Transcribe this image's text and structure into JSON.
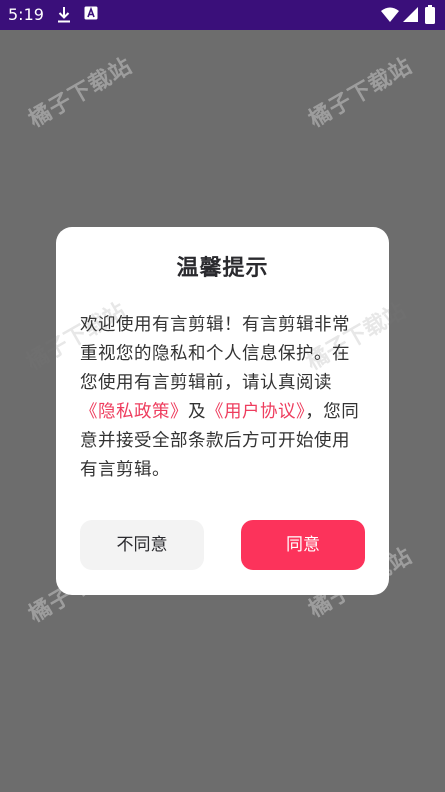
{
  "status_bar": {
    "time": "5:19",
    "background": "#3a0f7a",
    "icons": [
      "download-icon",
      "font-app-icon",
      "wifi-icon",
      "signal-icon",
      "battery-icon"
    ]
  },
  "watermark": {
    "text": "橘子下载站"
  },
  "dialog": {
    "title": "温馨提示",
    "message_part1": "欢迎使用有言剪辑！有言剪辑非常重视您的隐私和个人信息保护。在您使用有言剪辑前，请认真阅读",
    "privacy_policy_link": "《隐私政策》",
    "conjunction": "及",
    "user_agreement_link": "《用户协议》",
    "message_part2": "，您同意并接受全部条款后方可开始使用有言剪辑。",
    "disagree_label": "不同意",
    "agree_label": "同意",
    "accent_color": "#fc335b",
    "link_color": "#ee3d5e"
  }
}
